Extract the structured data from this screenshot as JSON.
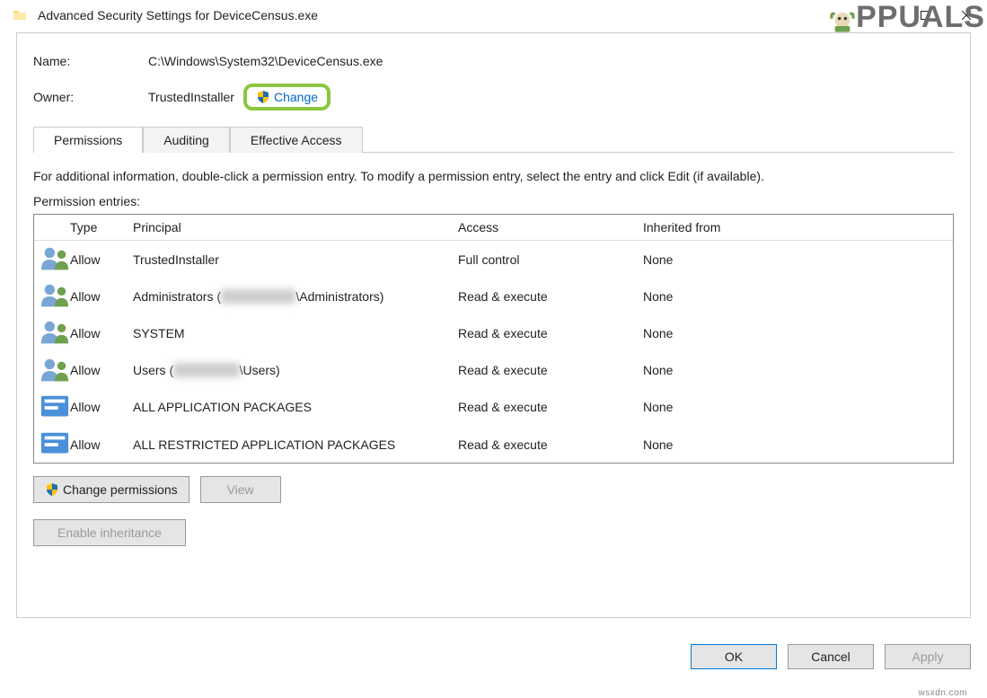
{
  "window": {
    "title": "Advanced Security Settings for DeviceCensus.exe"
  },
  "logo": "PPUALS",
  "fields": {
    "name_label": "Name:",
    "name_value": "C:\\Windows\\System32\\DeviceCensus.exe",
    "owner_label": "Owner:",
    "owner_value": "TrustedInstaller",
    "change_label": "Change"
  },
  "tabs": {
    "permissions": "Permissions",
    "auditing": "Auditing",
    "effective": "Effective Access"
  },
  "body": {
    "info": "For additional information, double-click a permission entry. To modify a permission entry, select the entry and click Edit (if available).",
    "entries_label": "Permission entries:"
  },
  "columns": {
    "type": "Type",
    "principal": "Principal",
    "access": "Access",
    "inherited": "Inherited from"
  },
  "rows": [
    {
      "icon": "people",
      "type": "Allow",
      "principal": "TrustedInstaller",
      "principal_suffix": "",
      "blurred": "",
      "access": "Full control",
      "inherited": "None"
    },
    {
      "icon": "people",
      "type": "Allow",
      "principal": "Administrators (",
      "principal_suffix": "\\Administrators)",
      "blurred": "████████",
      "access": "Read & execute",
      "inherited": "None"
    },
    {
      "icon": "people",
      "type": "Allow",
      "principal": "SYSTEM",
      "principal_suffix": "",
      "blurred": "",
      "access": "Read & execute",
      "inherited": "None"
    },
    {
      "icon": "people",
      "type": "Allow",
      "principal": "Users (",
      "principal_suffix": "\\Users)",
      "blurred": "███████",
      "access": "Read & execute",
      "inherited": "None"
    },
    {
      "icon": "package",
      "type": "Allow",
      "principal": "ALL APPLICATION PACKAGES",
      "principal_suffix": "",
      "blurred": "",
      "access": "Read & execute",
      "inherited": "None"
    },
    {
      "icon": "package",
      "type": "Allow",
      "principal": "ALL RESTRICTED APPLICATION PACKAGES",
      "principal_suffix": "",
      "blurred": "",
      "access": "Read & execute",
      "inherited": "None"
    }
  ],
  "buttons": {
    "change_permissions": "Change permissions",
    "view": "View",
    "enable_inheritance": "Enable inheritance",
    "ok": "OK",
    "cancel": "Cancel",
    "apply": "Apply"
  },
  "watermark": "wsxdn.com"
}
